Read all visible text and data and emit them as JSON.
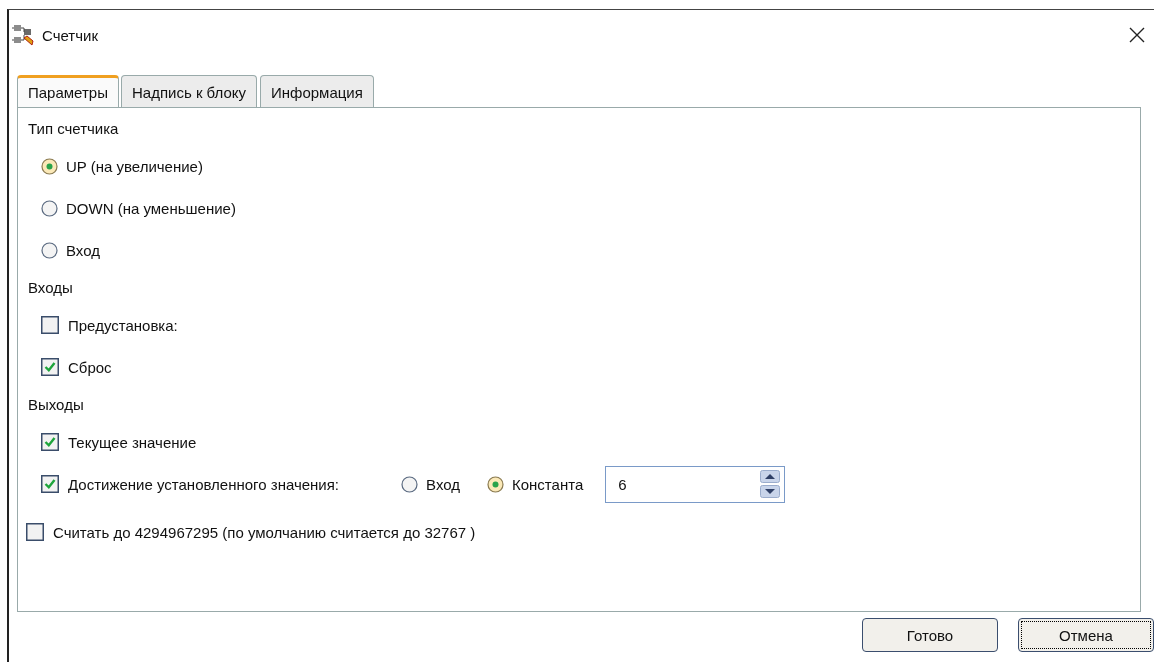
{
  "window": {
    "title": "Счетчик"
  },
  "tabs": [
    {
      "label": "Параметры",
      "selected": true
    },
    {
      "label": "Надпись к блоку",
      "selected": false
    },
    {
      "label": "Информация",
      "selected": false
    }
  ],
  "counter_type": {
    "label": "Тип счетчика",
    "options": [
      {
        "label": "UP (на увеличение)",
        "selected": true
      },
      {
        "label": "DOWN (на уменьшение)",
        "selected": false
      },
      {
        "label": "Вход",
        "selected": false
      }
    ]
  },
  "inputs": {
    "label": "Входы",
    "items": [
      {
        "label": "Предустановка:",
        "checked": false
      },
      {
        "label": "Сброс",
        "checked": true
      }
    ]
  },
  "outputs": {
    "label": "Выходы",
    "items": [
      {
        "label": "Текущее значение",
        "checked": true
      },
      {
        "label": "Достижение установленного значения:",
        "checked": true
      }
    ],
    "target_source": [
      {
        "label": "Вход",
        "selected": false
      },
      {
        "label": "Константа",
        "selected": true
      }
    ],
    "constant_value": "6"
  },
  "count_to_max": {
    "label": "Считать до 4294967295 (по умолчанию считается до 32767 )",
    "checked": false
  },
  "buttons": [
    {
      "label": "Готово",
      "focused": false
    },
    {
      "label": "Отмена",
      "focused": true
    }
  ]
}
